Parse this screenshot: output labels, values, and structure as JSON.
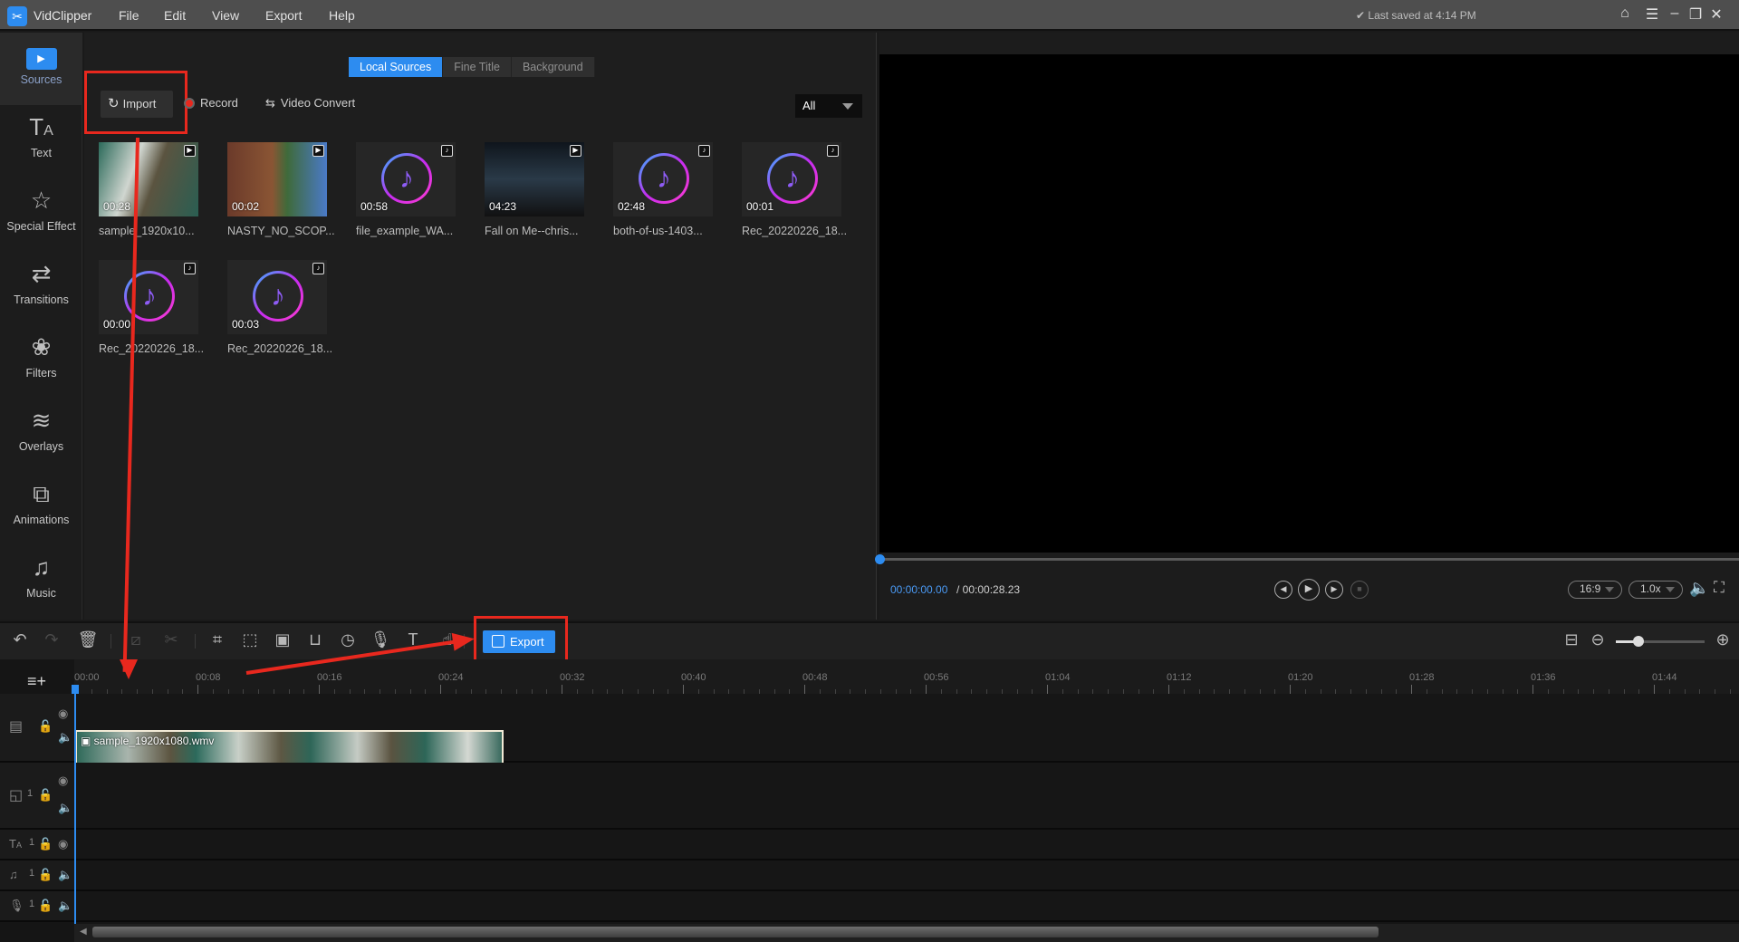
{
  "app": {
    "name": "VidClipper",
    "menu": [
      "File",
      "Edit",
      "View",
      "Export",
      "Help"
    ],
    "save_status": "Last saved at 4:14 PM"
  },
  "sidebar": {
    "items": [
      {
        "label": "Sources",
        "icon": "folder-play-icon",
        "active": true
      },
      {
        "label": "Text",
        "icon": "text-icon"
      },
      {
        "label": "Special Effect",
        "icon": "magic-star-icon"
      },
      {
        "label": "Transitions",
        "icon": "transition-icon"
      },
      {
        "label": "Filters",
        "icon": "filters-icon"
      },
      {
        "label": "Overlays",
        "icon": "layers-icon"
      },
      {
        "label": "Animations",
        "icon": "animation-icon"
      },
      {
        "label": "Music",
        "icon": "music-note-icon"
      }
    ]
  },
  "media": {
    "tabs": [
      {
        "label": "Local Sources",
        "active": true
      },
      {
        "label": "Fine Title"
      },
      {
        "label": "Background"
      }
    ],
    "actions": {
      "import": "Import",
      "record": "Record",
      "convert": "Video Convert"
    },
    "filter": "All",
    "items": [
      {
        "name": "sample_1920x10...",
        "duration": "00:28",
        "type": "video"
      },
      {
        "name": "NASTY_NO_SCOP...",
        "duration": "00:02",
        "type": "video"
      },
      {
        "name": "file_example_WA...",
        "duration": "00:58",
        "type": "audio"
      },
      {
        "name": "Fall on Me--chris...",
        "duration": "04:23",
        "type": "video"
      },
      {
        "name": "both-of-us-1403...",
        "duration": "02:48",
        "type": "audio"
      },
      {
        "name": "Rec_20220226_18...",
        "duration": "00:01",
        "type": "audio"
      },
      {
        "name": "Rec_20220226_18...",
        "duration": "00:00",
        "type": "audio"
      },
      {
        "name": "Rec_20220226_18...",
        "duration": "00:03",
        "type": "audio"
      }
    ]
  },
  "preview": {
    "current_time": "00:00:00.00",
    "total_time": "/ 00:00:28.23",
    "aspect_ratio": "16:9",
    "speed": "1.0x",
    "progress": 0
  },
  "toolbar": {
    "export_label": "Export",
    "zoom_level": 0.25
  },
  "timeline": {
    "ruler_ticks": [
      "00:00",
      "00:08",
      "00:16",
      "00:24",
      "00:32",
      "00:40",
      "00:48",
      "00:56",
      "01:04",
      "01:12",
      "01:20",
      "01:28",
      "01:36",
      "01:44"
    ],
    "clip": {
      "name": "sample_1920x1080.wmv",
      "track": "video"
    },
    "track_counts": {
      "overlay": "1",
      "text": "1",
      "music": "1",
      "voice": "1"
    }
  },
  "annotations": {
    "highlight_color": "#e8281e",
    "accent": "#2d8cf0"
  }
}
